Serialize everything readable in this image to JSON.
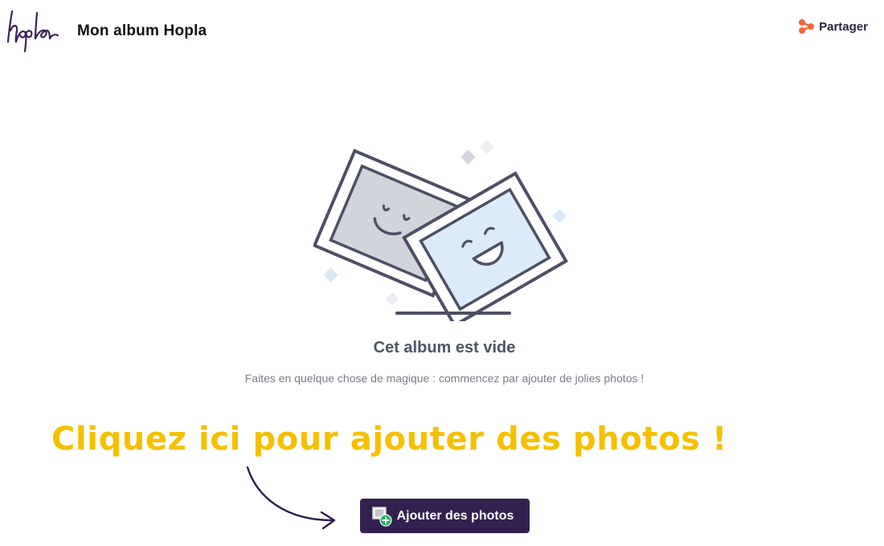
{
  "header": {
    "logo_text": "hopla",
    "album_title": "Mon album Hopla",
    "share_label": "Partager"
  },
  "empty_state": {
    "illustration_icon": "photo-frames-smiley-illustration",
    "title": "Cet album est vide",
    "subtitle": "Faites en quelque chose de magique : commencez par ajouter de jolies photos !"
  },
  "annotation": {
    "text": "Cliquez ici pour ajouter des photos !",
    "arrow_icon": "curved-arrow-icon"
  },
  "actions": {
    "add_photos_label": "Ajouter des photos",
    "add_photos_icon": "add-photo-icon"
  },
  "colors": {
    "brand_purple": "#33204f",
    "share_accent": "#f0673e",
    "annotation_yellow": "#f6c000",
    "empty_title": "#4f5466"
  }
}
